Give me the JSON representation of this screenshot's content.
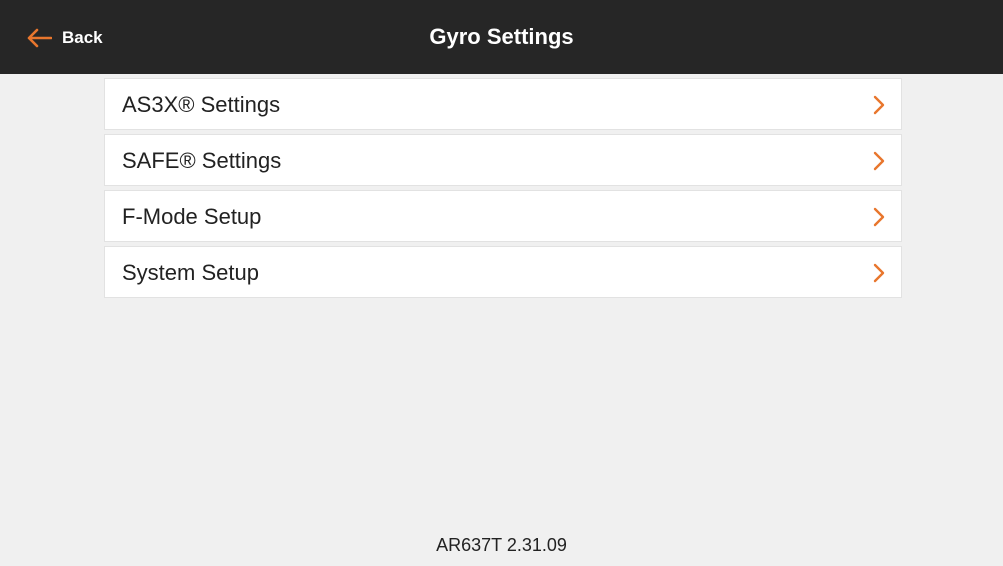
{
  "header": {
    "back_label": "Back",
    "back_icon": "arrow-left-icon",
    "title": "Gyro Settings"
  },
  "menu": {
    "items": [
      {
        "label": "AS3X® Settings",
        "icon": "chevron-right-icon"
      },
      {
        "label": "SAFE® Settings",
        "icon": "chevron-right-icon"
      },
      {
        "label": "F-Mode Setup",
        "icon": "chevron-right-icon"
      },
      {
        "label": "System Setup",
        "icon": "chevron-right-icon"
      }
    ]
  },
  "footer": {
    "version": "AR637T 2.31.09"
  },
  "colors": {
    "accent": "#e8762d",
    "header_bg": "#262626",
    "page_bg": "#f0f0f0"
  }
}
